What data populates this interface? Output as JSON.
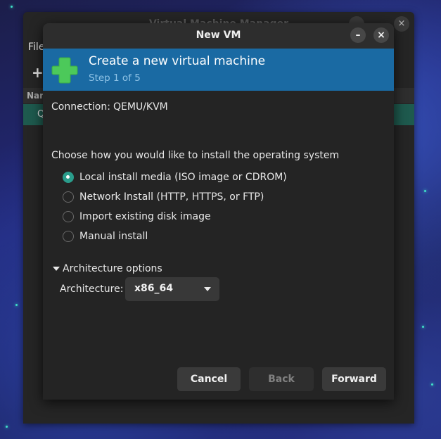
{
  "background_window": {
    "title": "Virtual Machine Manager",
    "menu_file": "File",
    "list_header": "Nar",
    "selected_row": "Q",
    "minimize_label": "–",
    "close_label": "×"
  },
  "dialog": {
    "title": "New VM",
    "minimize_label": "–",
    "close_label": "×",
    "banner": {
      "title": "Create a new virtual machine",
      "step": "Step 1 of 5"
    },
    "connection": {
      "label": "Connection:",
      "value": "QEMU/KVM"
    },
    "install_prompt": "Choose how you would like to install the operating system",
    "install_options": [
      {
        "label": "Local install media (ISO image or CDROM)",
        "selected": true
      },
      {
        "label": "Network Install (HTTP, HTTPS, or FTP)",
        "selected": false
      },
      {
        "label": "Import existing disk image",
        "selected": false
      },
      {
        "label": "Manual install",
        "selected": false
      }
    ],
    "architecture": {
      "expander_label": "Architecture options",
      "label": "Architecture:",
      "value": "x86_64"
    },
    "buttons": {
      "cancel": "Cancel",
      "back": "Back",
      "forward": "Forward"
    }
  },
  "colors": {
    "banner": "#1a6aa3",
    "radio_selected": "#2a9d8c",
    "plus_icon": "#4cc95a"
  },
  "icons": {
    "add": "plus-icon",
    "minimize": "minimize-icon",
    "close": "close-icon",
    "expander": "triangle-down-icon",
    "dropdown": "chevron-down-icon"
  }
}
